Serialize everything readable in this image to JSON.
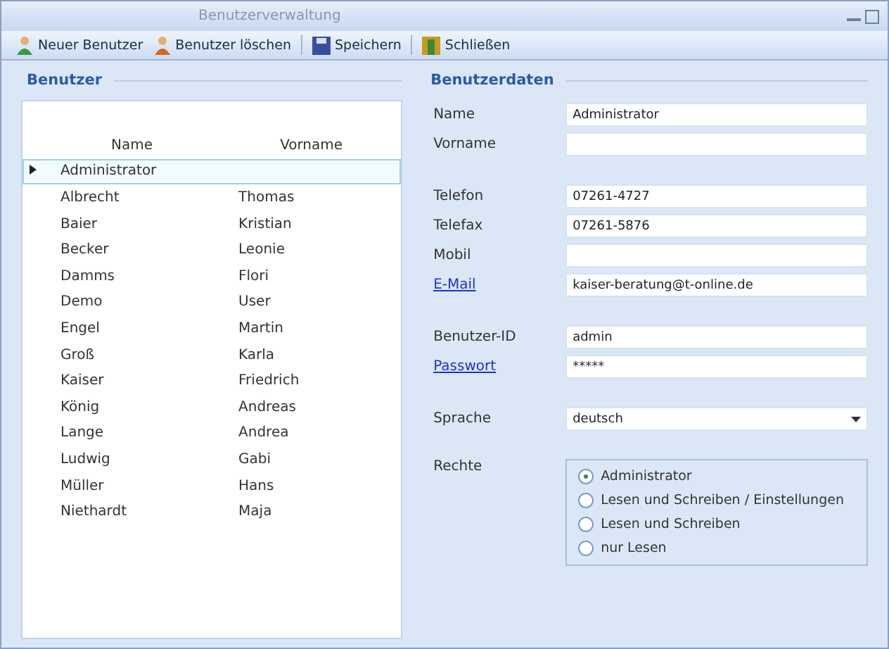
{
  "window": {
    "title": "Benutzerverwaltung"
  },
  "toolbar": [
    {
      "label": "Neuer Benutzer",
      "kind": "user-add"
    },
    {
      "label": "Benutzer löschen",
      "kind": "user-delete"
    },
    {
      "label": "Speichern",
      "kind": "save"
    },
    {
      "label": "Schließen",
      "kind": "close"
    }
  ],
  "users_panel": {
    "heading": "Benutzer",
    "columns": [
      "Name",
      "Vorname"
    ],
    "rows": [
      {
        "name": "Administrator",
        "first_name": "",
        "selected": true
      },
      {
        "name": "Albrecht",
        "first_name": "Thomas",
        "selected": false
      },
      {
        "name": "Baier",
        "first_name": "Kristian",
        "selected": false
      },
      {
        "name": "Becker",
        "first_name": "Leonie",
        "selected": false
      },
      {
        "name": "Damms",
        "first_name": "Flori",
        "selected": false
      },
      {
        "name": "Demo",
        "first_name": "User",
        "selected": false
      },
      {
        "name": "Engel",
        "first_name": "Martin",
        "selected": false
      },
      {
        "name": "Groß",
        "first_name": "Karla",
        "selected": false
      },
      {
        "name": "Kaiser",
        "first_name": "Friedrich",
        "selected": false
      },
      {
        "name": "König",
        "first_name": "Andreas",
        "selected": false
      },
      {
        "name": "Lange",
        "first_name": "Andrea",
        "selected": false
      },
      {
        "name": "Ludwig",
        "first_name": "Gabi",
        "selected": false
      },
      {
        "name": "Müller",
        "first_name": "Hans",
        "selected": false
      },
      {
        "name": "Niethardt",
        "first_name": "Maja",
        "selected": false
      }
    ]
  },
  "details_panel": {
    "heading": "Benutzerdaten",
    "field_groups": [
      [
        {
          "label": "Name",
          "value": "Administrator",
          "kind": "text"
        },
        {
          "label": "Vorname",
          "kind": "text"
        }
      ],
      [
        {
          "label": "Telefon",
          "value": "07261-4727",
          "kind": "text"
        },
        {
          "label": "Telefax",
          "value": "07261-5876",
          "kind": "text"
        },
        {
          "label": "Mobil",
          "kind": "text"
        },
        {
          "label": "E-Mail",
          "value": "kaiser-beratung@t-online.de",
          "kind": "link"
        }
      ],
      [
        {
          "label": "Benutzer-ID",
          "value": "admin",
          "kind": "text"
        },
        {
          "label": "Passwort",
          "value": "*****",
          "kind": "link"
        }
      ],
      [
        {
          "label": "Sprache",
          "value": "deutsch",
          "kind": "select"
        }
      ]
    ],
    "rights": {
      "label": "Rechte",
      "options": [
        {
          "label": "Administrator",
          "selected": true
        },
        {
          "label": "Lesen und Schreiben / Einstellungen",
          "selected": false
        },
        {
          "label": "Lesen und Schreiben",
          "selected": false
        },
        {
          "label": "nur Lesen",
          "selected": false
        }
      ]
    }
  }
}
